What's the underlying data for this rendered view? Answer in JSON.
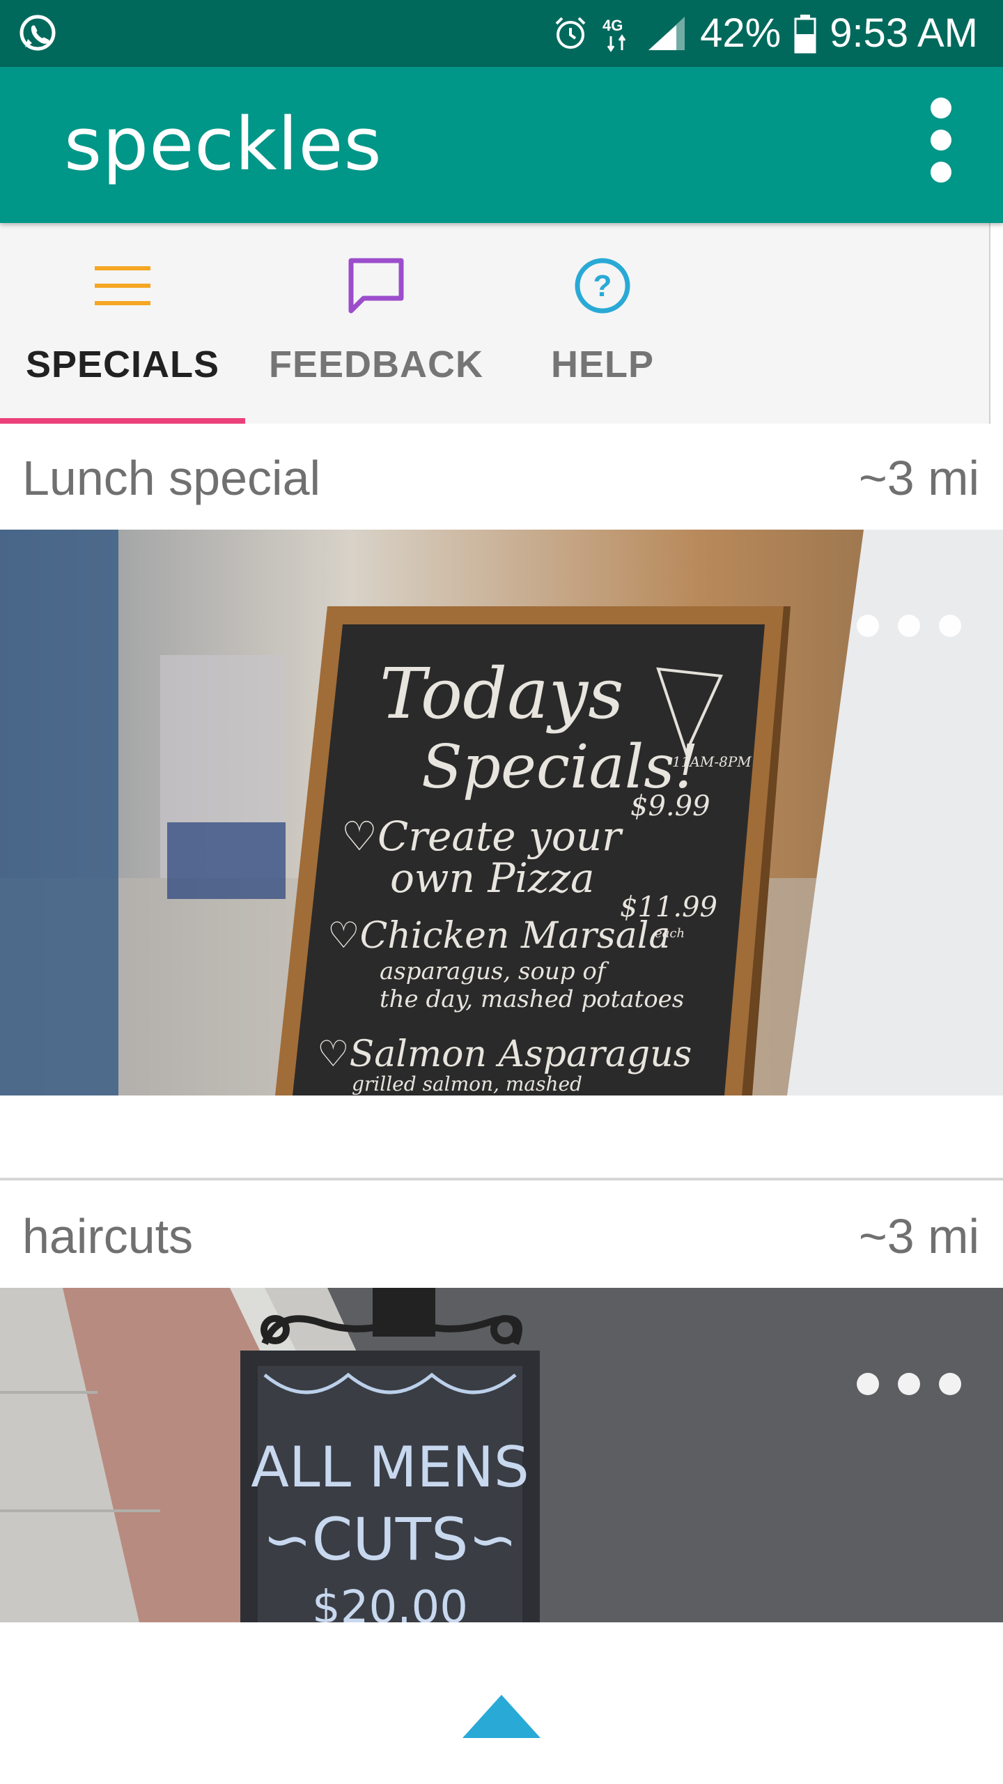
{
  "status_bar": {
    "battery": "42%",
    "time": "9:53 AM",
    "network": "4G",
    "icons": [
      "whatsapp-icon",
      "alarm-icon",
      "network-4g-icon",
      "signal-icon",
      "battery-icon"
    ]
  },
  "app_bar": {
    "title": "speckles",
    "color": "#009688",
    "status_color": "#00695c"
  },
  "tabs": [
    {
      "label": "SPECIALS",
      "icon": "menu-icon",
      "icon_color": "#f5a623",
      "active": true
    },
    {
      "label": "FEEDBACK",
      "icon": "chat-icon",
      "icon_color": "#9c4dcc",
      "active": false
    },
    {
      "label": "HELP",
      "icon": "help-icon",
      "icon_color": "#29a9d6",
      "active": false
    }
  ],
  "tab_indicator_color": "#ec407a",
  "cards": [
    {
      "title": "Lunch special",
      "distance": "~3 mi",
      "image": "chalkboard-specials-photo"
    },
    {
      "title": "haircuts",
      "distance": "~3 mi",
      "image": "chalkboard-haircuts-photo"
    }
  ],
  "photo_text": {
    "card1": {
      "heading_1": "Todays",
      "heading_2": "Specials!",
      "line_1": "♡Create your",
      "line_2": "own Pizza",
      "line_3": "♡Chicken Marsala",
      "line_4": "asparagus, soup of",
      "line_5": "the day, mashed potatoes",
      "line_6": "♡Salmon Asparagus",
      "line_7": "grilled salmon, mashed",
      "price_1": "$9.99",
      "price_2": "$11.99",
      "pizza_note": "11AM-8PM",
      "each_note": "each"
    },
    "card2": {
      "line_1": "ALL MENS",
      "line_2": "∽CUTS∽",
      "price": "$20.00"
    }
  },
  "bottom": {
    "scroll_icon": "arrow-up-icon",
    "scroll_color": "#29a9d6"
  }
}
